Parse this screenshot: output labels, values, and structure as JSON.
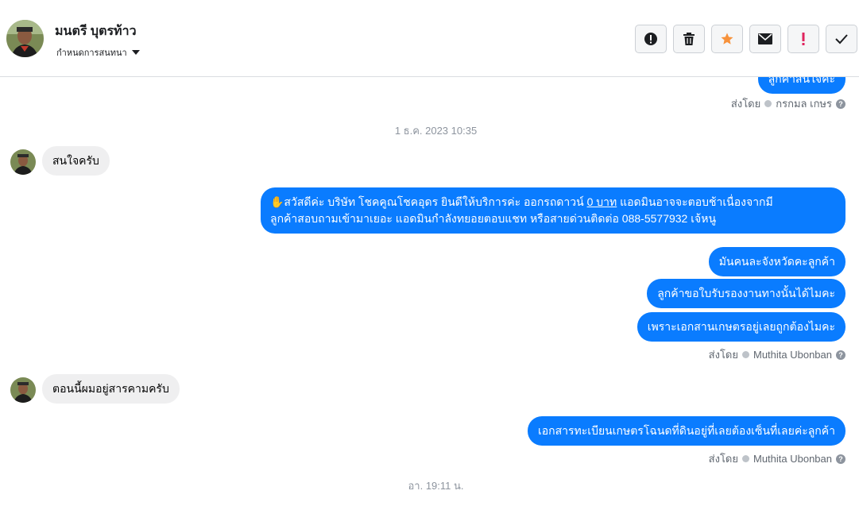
{
  "header": {
    "contact_name": "มนตรี บุตรท้าว",
    "assign_label": "กำหนดการสนทนา",
    "actions": [
      {
        "icon": "alert-circle-icon",
        "name": "mark-spam-button"
      },
      {
        "icon": "trash-icon",
        "name": "delete-button"
      },
      {
        "icon": "star-icon",
        "name": "star-button"
      },
      {
        "icon": "envelope-icon",
        "name": "mark-unread-button"
      },
      {
        "icon": "exclamation-icon",
        "name": "flag-button"
      },
      {
        "icon": "check-icon",
        "name": "done-button"
      }
    ]
  },
  "colors": {
    "outgoing_bubble": "#0a7cff",
    "incoming_bubble": "#efeff0",
    "star": "#f7923b",
    "flag": "#e0245e"
  },
  "messages": {
    "top_partial": "ลูกค้าสนใจค่ะ",
    "sent_by_1": {
      "prefix": "ส่งโดย",
      "name": "กรกมล เกษร"
    },
    "timestamp_1": "1 ธ.ค. 2023 10:35",
    "in_1": "สนใจครับ",
    "out_1_line1_a": "✋สวัสดีค่ะ บริษัท โชคคูณโชคอุดร ยินดีให้บริการค่ะ ออกรถดาวน์ ",
    "out_1_price": "0 บาท",
    "out_1_line1_b": " แอดมินอาจจะตอบช้าเนื่องจากมี",
    "out_1_line2": "ลูกค้าสอบถามเข้ามาเยอะ แอดมินกำลังทยอยตอบแชท หรือสายด่วนติดต่อ 088-5577932 เจ้หนู",
    "out_2": "มันคนละจังหวัดคะลูกค้า",
    "out_3": "ลูกค้าขอใบรับรองงานทางนั้นได้ไมคะ",
    "out_4": "เพราะเอกสานเกษตรอยู่เลยถูกต้องไมคะ",
    "sent_by_2": {
      "prefix": "ส่งโดย",
      "name": "Muthita Ubonban"
    },
    "in_2": "ตอนนี้ผมอยู่สารคามครับ",
    "out_5": "เอกสารทะเบียนเกษตรโฉนดที่ดินอยู่ที่เลยต้องเซ็นที่เลยค่ะลูกค้า",
    "sent_by_3": {
      "prefix": "ส่งโดย",
      "name": "Muthita Ubonban"
    },
    "timestamp_2": "อา. 19:11 น."
  }
}
